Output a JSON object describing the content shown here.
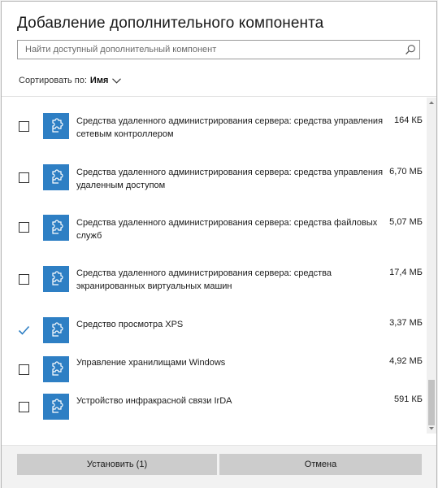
{
  "dialog": {
    "title": "Добавление дополнительного компонента"
  },
  "search": {
    "placeholder": "Найти доступный дополнительный компонент",
    "value": "",
    "icon": "search-icon"
  },
  "sort": {
    "label": "Сортировать по:",
    "value": "Имя",
    "icon": "chevron-down-icon"
  },
  "features": [
    {
      "name_line1": "Средства удаленного администрирования сервера: средства управления",
      "name_line2": "сетевым контроллером",
      "size": "164 КБ",
      "checked": false
    },
    {
      "name_line1": "Средства удаленного администрирования сервера: средства управления",
      "name_line2": "удаленным доступом",
      "size": "6,70 МБ",
      "checked": false
    },
    {
      "name_line1": "Средства удаленного администрирования сервера: средства файловых",
      "name_line2": "служб",
      "size": "5,07 МБ",
      "checked": false
    },
    {
      "name_line1": "Средства удаленного администрирования сервера: средства",
      "name_line2": "экранированных виртуальных машин",
      "size": "17,4 МБ",
      "checked": false
    },
    {
      "name_line1": "Средство просмотра XPS",
      "name_line2": "",
      "size": "3,37 МБ",
      "checked": true
    },
    {
      "name_line1": "Управление хранилищами Windows",
      "name_line2": "",
      "size": "4,92 МБ",
      "checked": false
    },
    {
      "name_line1": "Устройство инфракрасной связи IrDA",
      "name_line2": "",
      "size": "591 КБ",
      "checked": false
    }
  ],
  "feature_icon": "puzzle-piece-icon",
  "buttons": {
    "install": "Установить (1)",
    "cancel": "Отмена"
  },
  "colors": {
    "accent": "#2e7fc4",
    "button_bg": "#cccccc",
    "footer_bg": "#f2f2f2"
  }
}
